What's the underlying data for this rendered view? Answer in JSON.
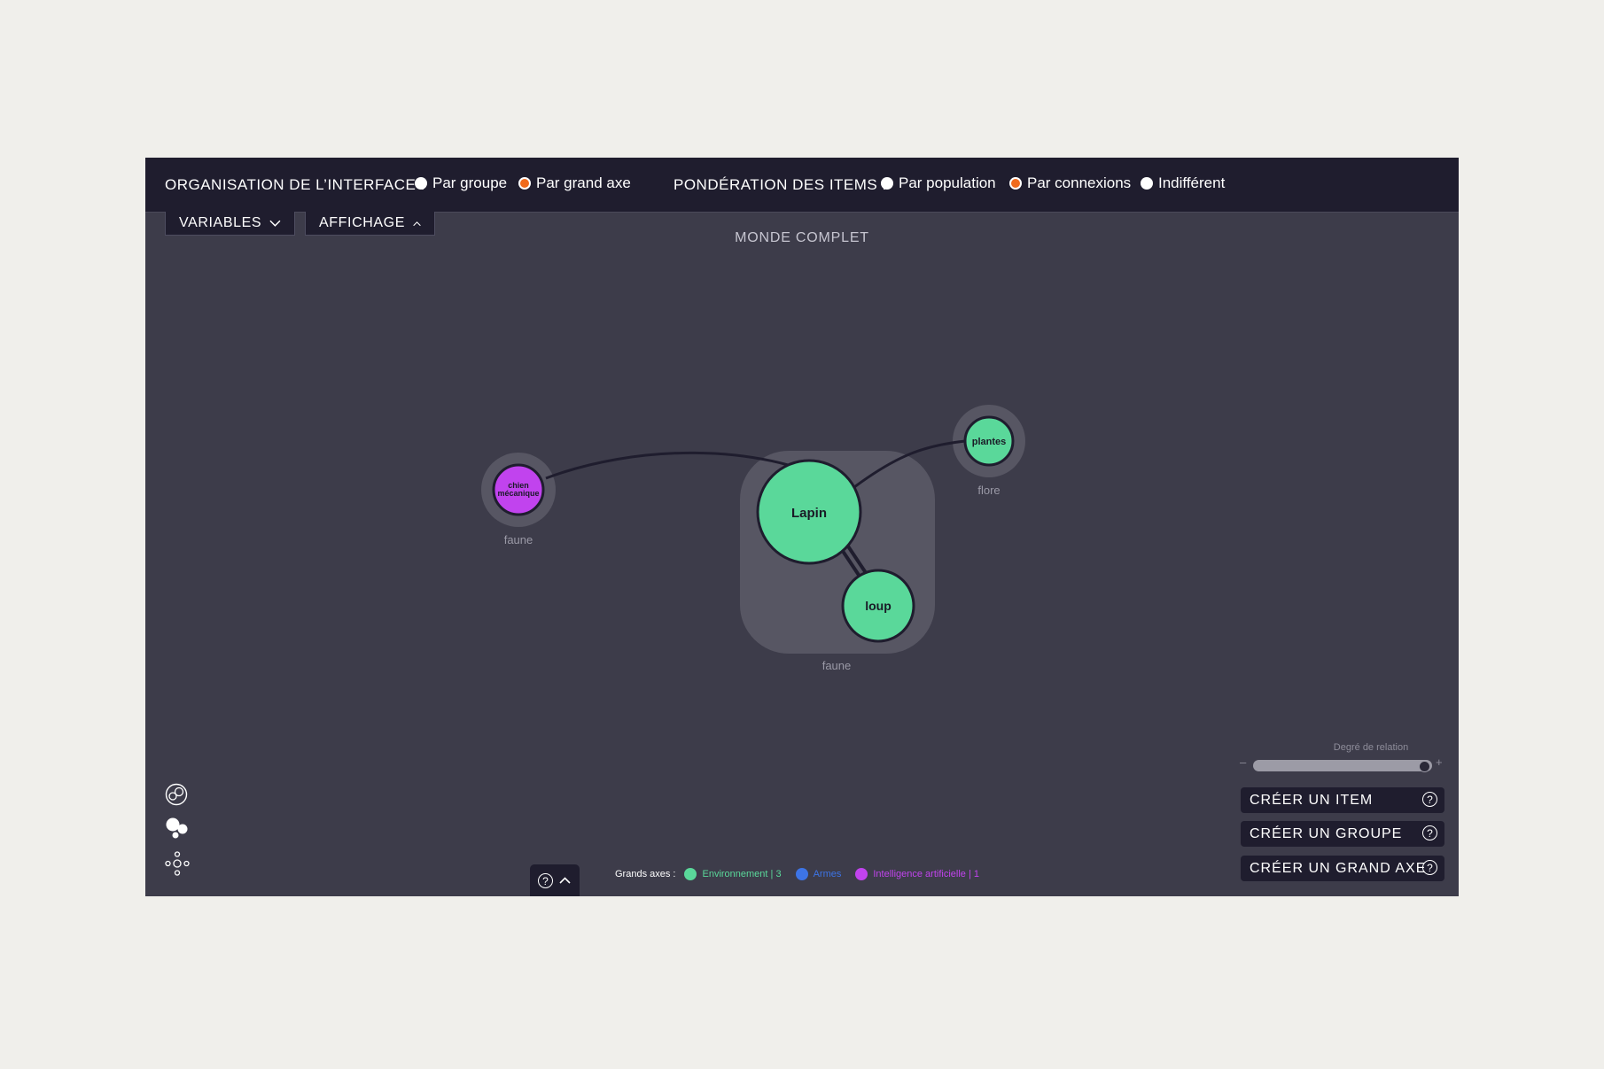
{
  "topbar": {
    "organisation_label": "ORGANISATION DE L’INTERFACE :",
    "organisation_options": [
      {
        "label": "Par groupe",
        "selected": false
      },
      {
        "label": "Par grand axe",
        "selected": true
      }
    ],
    "ponderation_label": "PONDÉRATION DES ITEMS :",
    "ponderation_options": [
      {
        "label": "Par population",
        "selected": false
      },
      {
        "label": "Par connexions",
        "selected": true
      },
      {
        "label": "Indifférent",
        "selected": false
      }
    ]
  },
  "menus": {
    "variables": {
      "label": "VARIABLES",
      "icon": "chevron-down-icon"
    },
    "affichage": {
      "label": "AFFICHAGE",
      "icon": "chevron-up-icon"
    }
  },
  "world_title": "MONDE COMPLET",
  "graph": {
    "nodes": [
      {
        "id": "chien",
        "label_lines": [
          "chien",
          "mécanique"
        ],
        "group": "faune",
        "axis": "Intelligence artificielle"
      },
      {
        "id": "lapin",
        "label_lines": [
          "Lapin"
        ],
        "group": "faune",
        "axis": "Environnement"
      },
      {
        "id": "loup",
        "label_lines": [
          "loup"
        ],
        "group": "faune",
        "axis": "Environnement"
      },
      {
        "id": "plantes",
        "label_lines": [
          "plantes"
        ],
        "group": "flore",
        "axis": "Environnement"
      }
    ],
    "edges": [
      {
        "from": "chien",
        "to": "lapin"
      },
      {
        "from": "lapin",
        "to": "plantes"
      },
      {
        "from": "lapin",
        "to": "loup"
      }
    ],
    "group_labels": {
      "chien_group": "faune",
      "main_group": "faune",
      "plantes_group": "flore"
    }
  },
  "relation_slider": {
    "label": "Degré de relation",
    "minus": "–",
    "plus": "+",
    "value_fraction": 0.99
  },
  "actions": {
    "create_item": "CRÉER UN ITEM",
    "create_group": "CRÉER UN GROUPE",
    "create_axis": "CRÉER UN GRAND AXE",
    "help_symbol": "?"
  },
  "view_icons": [
    "clusters-view-icon",
    "bubbles-view-icon",
    "network-view-icon"
  ],
  "help_tab": {
    "symbol": "?",
    "icon": "chevron-up-icon"
  },
  "legend": {
    "lead": "Grands axes :",
    "items": [
      {
        "label": "Environnement | 3",
        "color": "#5ad89a"
      },
      {
        "label": "Armes",
        "color": "#3d74e6"
      },
      {
        "label": "Intelligence artificielle | 1",
        "color": "#c143ee"
      }
    ]
  },
  "colors": {
    "environnement": "#5ad89a",
    "armes": "#3d74e6",
    "intelligence_artificielle": "#c143ee",
    "selected_radio": "#f06a1c"
  }
}
